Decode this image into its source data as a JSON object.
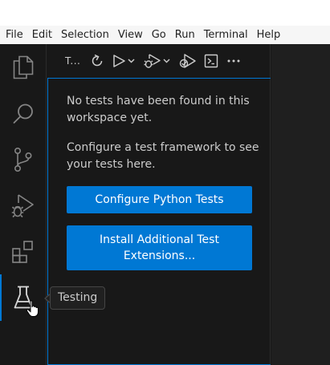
{
  "menubar": {
    "items": [
      "File",
      "Edit",
      "Selection",
      "View",
      "Go",
      "Run",
      "Terminal",
      "Help"
    ]
  },
  "activity_bar": {
    "items": [
      {
        "name": "explorer",
        "icon": "files-icon"
      },
      {
        "name": "search",
        "icon": "search-icon"
      },
      {
        "name": "source-control",
        "icon": "source-control-icon"
      },
      {
        "name": "run-and-debug",
        "icon": "run-debug-icon"
      },
      {
        "name": "extensions",
        "icon": "extensions-icon"
      },
      {
        "name": "testing",
        "icon": "beaker-icon",
        "active": true
      }
    ]
  },
  "sidebar": {
    "title": "T...",
    "toolbar": [
      "refresh-icon",
      "run-tests-icon",
      "debug-tests-icon",
      "run-with-coverage-icon",
      "show-output-icon",
      "more-icon"
    ]
  },
  "testing_view": {
    "message_1": "No tests have been found in this workspace yet.",
    "message_2": "Configure a test framework to see your tests here.",
    "button_configure": "Configure Python Tests",
    "button_install": "Install Additional Test Extensions..."
  },
  "tooltip": {
    "text": "Testing"
  },
  "colors": {
    "accent": "#0078d4",
    "background": "#181818",
    "foreground": "#cccccc",
    "icon": "#858585"
  }
}
